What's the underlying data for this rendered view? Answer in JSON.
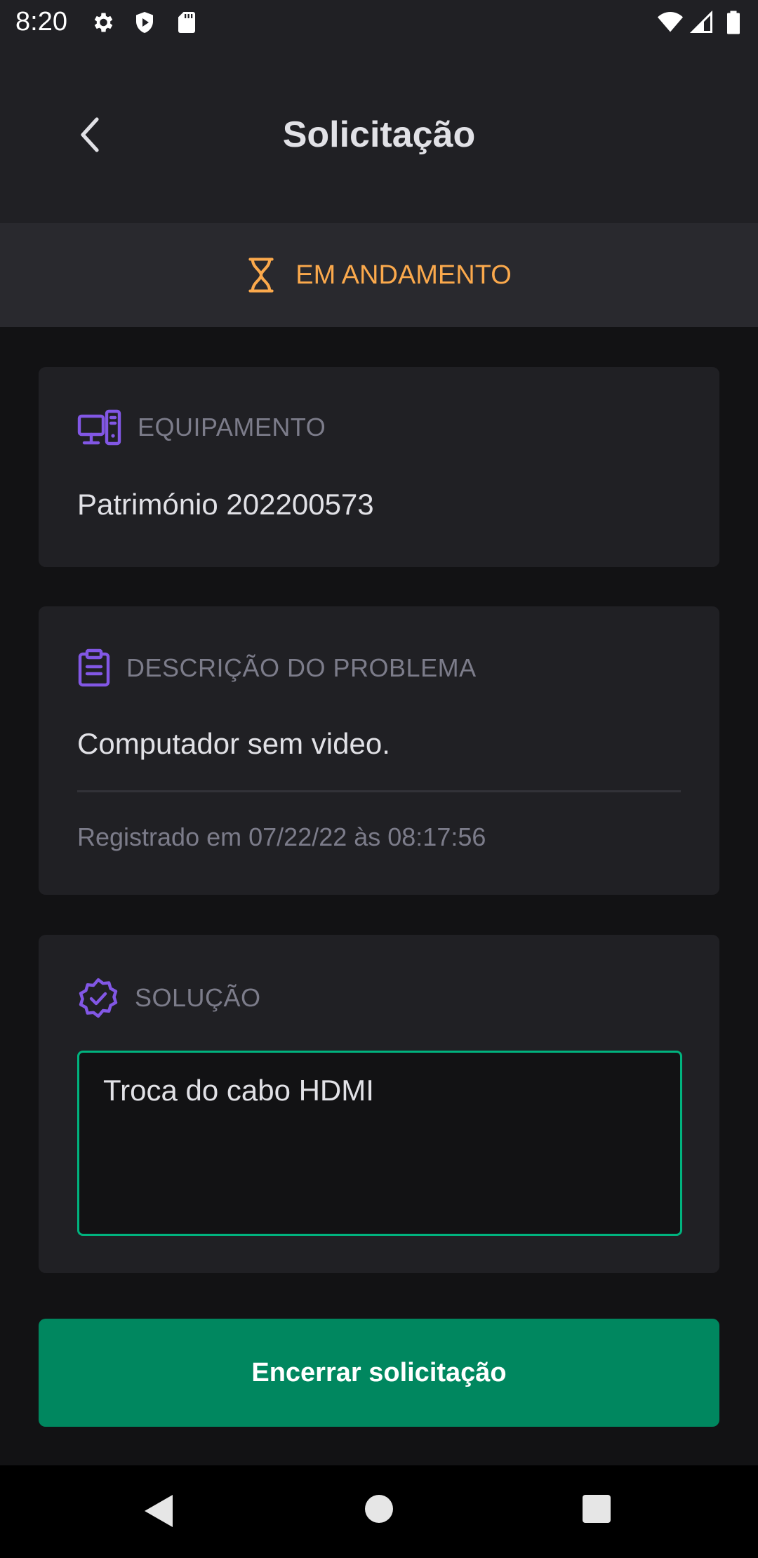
{
  "status_bar": {
    "time": "8:20",
    "icons_left": [
      "gear-icon",
      "shield-play-icon",
      "sd-card-icon"
    ],
    "icons_right": [
      "wifi-icon",
      "signal-icon",
      "battery-icon"
    ]
  },
  "header": {
    "title": "Solicitação",
    "back_icon": "chevron-left-icon"
  },
  "status_banner": {
    "icon": "hourglass-icon",
    "label": "EM ANDAMENTO",
    "color": "#FBA94C"
  },
  "equipment_card": {
    "icon": "desktop-computer-icon",
    "label": "EQUIPAMENTO",
    "value": "Património 202200573"
  },
  "problem_card": {
    "icon": "clipboard-icon",
    "label": "DESCRIÇÃO DO PROBLEMA",
    "value": "Computador sem video.",
    "registered": "Registrado em 07/22/22 às 08:17:56"
  },
  "solution_card": {
    "icon": "verified-badge-icon",
    "label": "SOLUÇÃO",
    "value": "Troca do cabo HDMI"
  },
  "actions": {
    "close_label": "Encerrar solicitação"
  },
  "colors": {
    "accent": "#8257E5",
    "success": "#00875F",
    "success_border": "#00B37E",
    "warning": "#FBA94C",
    "background": "#121214",
    "surface": "#202024"
  }
}
